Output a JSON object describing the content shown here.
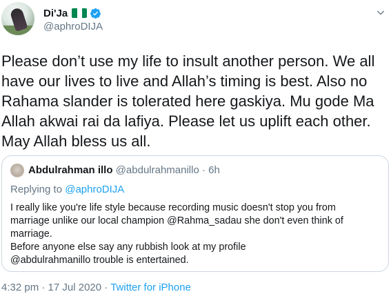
{
  "author": {
    "display_name": "Di'Ja",
    "handle": "@aphroDIJA",
    "flag_colors": [
      "#008751",
      "#ffffff",
      "#008751"
    ],
    "verified_icon": "verified-badge-icon",
    "verified_color": "#1da1f2"
  },
  "tweet": {
    "text": "Please don’t use my life to insult another person. We all have our lives to live and Allah’s timing is best. Also no Rahama slander is tolerated here gaskiya. Mu gode Ma Allah akwai rai da lafiya. Please let us uplift each other. May Allah bless us all."
  },
  "quote": {
    "author_name": "Abdulrahman illo",
    "author_handle": "@abdulrahmanillo",
    "separator": "·",
    "time": "6h",
    "replying_prefix": "Replying to",
    "replying_to": "@aphroDIJA",
    "body_lines": [
      "I really like you're life style because recording music doesn't stop you from",
      "marriage unlike our local champion @Rahma_sadau she don't even think of",
      "marriage.",
      "Before anyone else say any rubbish look at my profile",
      "@abdulrahmanillo trouble is entertained."
    ]
  },
  "footer": {
    "time": "4:32 pm",
    "separator1": "·",
    "date": "17 Jul 2020",
    "separator2": "·",
    "source": "Twitter for iPhone"
  },
  "colors": {
    "text": "#14171a",
    "muted": "#657786",
    "link": "#1da1f2",
    "border": "#ccd6dd"
  },
  "icons": {
    "menu": "chevron-down-icon"
  }
}
